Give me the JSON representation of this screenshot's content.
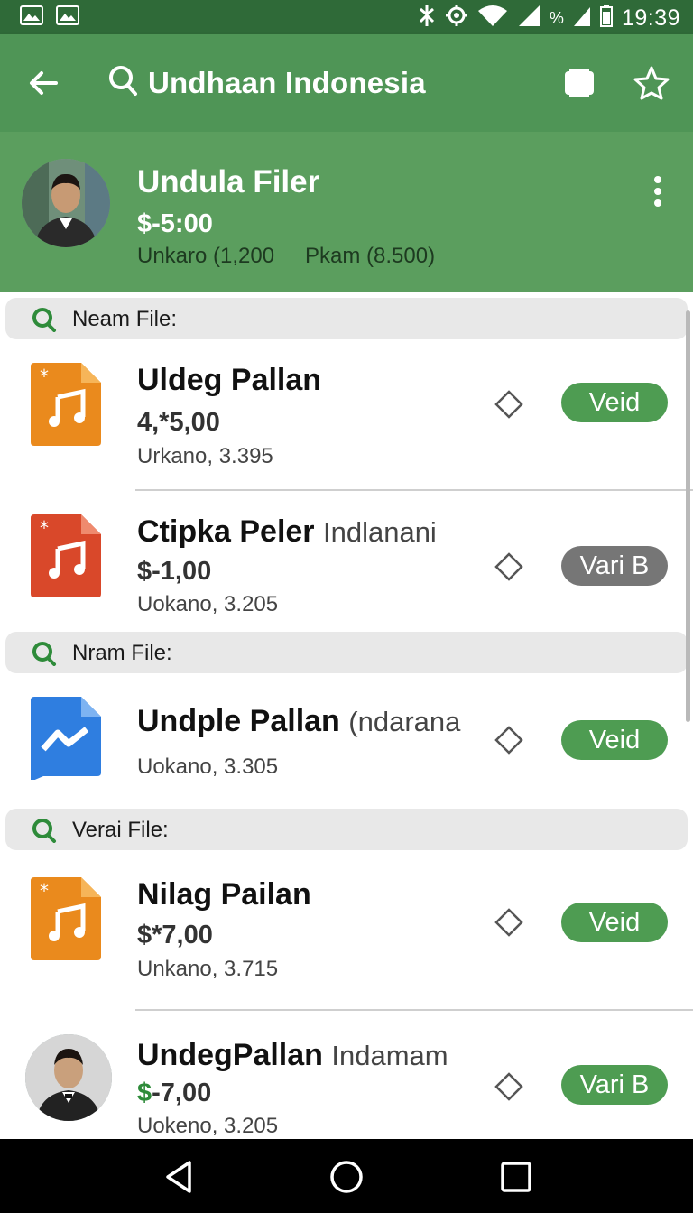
{
  "status_bar": {
    "time": "19:39",
    "battery_percent_label": "%"
  },
  "app_bar": {
    "title": "Undhaan Indonesia"
  },
  "profile": {
    "name": "Undula Filer",
    "price": "$-5:00",
    "stat_left": "Unkaro (1,200",
    "stat_right": "Pkam (8.500)"
  },
  "sections": [
    {
      "label": "Neam File:"
    },
    {
      "label": "Nram File:"
    },
    {
      "label": "Verai File:"
    }
  ],
  "items": [
    {
      "title": "Uldeg Pallan",
      "subtitle": "",
      "price": "4,*5,00",
      "meta": "Urkano, 3.395",
      "badge": "Veid",
      "icon": "music-file-orange-icon"
    },
    {
      "title": "Ctipka Peler",
      "subtitle": "Indlanani",
      "price": "$-1,00",
      "meta": "Uokano, 3.205",
      "badge": "Vari B",
      "icon": "music-file-red-icon"
    },
    {
      "title": "Undple Pallan",
      "subtitle": "(ndarana",
      "price": "",
      "meta": "Uokano, 3.305",
      "badge": "Veid",
      "icon": "messenger-file-blue-icon"
    },
    {
      "title": "Nilag Pailan",
      "subtitle": "",
      "price": "$*7,00",
      "meta": "Unkano, 3.715",
      "badge": "Veid",
      "icon": "music-file-orange-icon"
    },
    {
      "title": "UndegPallan",
      "subtitle": "Indamam",
      "price_prefix": "$",
      "price": "-7,00",
      "meta": "Uokeno, 3.205",
      "badge": "Vari B",
      "icon": "avatar"
    }
  ],
  "colors": {
    "status_bar": "#2f6a38",
    "app_bar": "#4f9556",
    "profile_bg": "#5b9e5e",
    "badge_green": "#4e9c52",
    "badge_gray": "#767676",
    "accent_green": "#2e8b3a"
  }
}
